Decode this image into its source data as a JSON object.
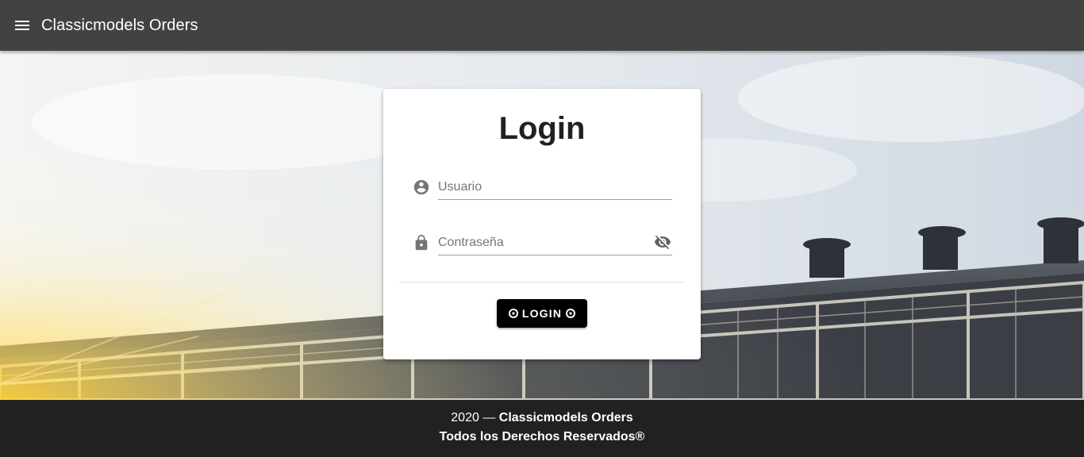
{
  "app_bar": {
    "title": "Classicmodels Orders",
    "menu_icon": "menu-icon"
  },
  "login_card": {
    "title": "Login",
    "username": {
      "placeholder": "Usuario",
      "value": "",
      "icon": "account-circle-icon"
    },
    "password": {
      "placeholder": "Contraseña",
      "value": "",
      "icon": "lock-icon",
      "toggle_icon": "eye-off-icon"
    },
    "button": {
      "label": "LOGIN",
      "icon": "circle-small-icon"
    }
  },
  "footer": {
    "year": "2020",
    "separator": "—",
    "app_name": "Classicmodels Orders",
    "rights": "Todos los Derechos Reservados®"
  },
  "colors": {
    "app_bar": "#424242",
    "footer": "#212121",
    "button": "#000000",
    "card": "#ffffff"
  }
}
